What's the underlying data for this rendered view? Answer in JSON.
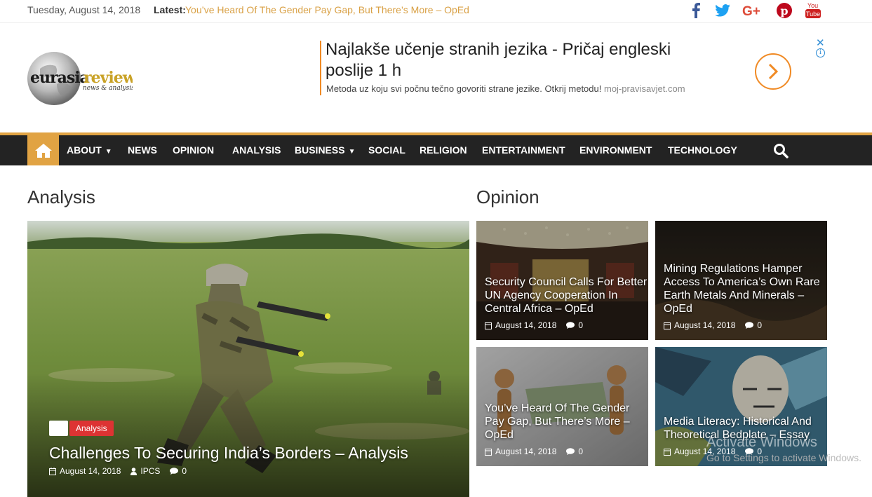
{
  "topbar": {
    "date": "Tuesday, August 14, 2018",
    "latest_label": "Latest:",
    "latest_link": "You’ve Heard Of The Gender Pay Gap, But There’s More – OpEd",
    "social": [
      "facebook-icon",
      "twitter-icon",
      "google-plus-icon",
      "pinterest-icon",
      "youtube-icon"
    ]
  },
  "logo": {
    "main": "eurasiareview",
    "sub": "news & analysis"
  },
  "ad": {
    "title": "Najlakše učenje stranih jezika - Pričaj engleski poslije 1 h",
    "description": "Metoda uz koju svi počnu tečno govoriti strane jezike. Otkrij metodu!",
    "domain": "moj-pravisavjet.com",
    "close": "✕",
    "info": "i"
  },
  "nav": {
    "items": [
      "About",
      "News",
      "Opinion",
      "Analysis",
      "Business",
      "Social",
      "Religion",
      "Entertainment",
      "Environment",
      "Technology"
    ],
    "caret": "⌄"
  },
  "sections": {
    "analysis": "Analysis",
    "opinion": "Opinion"
  },
  "feature": {
    "category": "Analysis",
    "title": "Challenges To Securing India’s Borders – Analysis",
    "date": "August 14, 2018",
    "author": "IPCS",
    "comments": "0"
  },
  "opinion_cards": [
    {
      "title": "Security Council Calls For Better UN Agency Cooperation In Central Africa – OpEd",
      "date": "August 14, 2018",
      "comments": "0"
    },
    {
      "title": "Mining Regulations Hamper Access To America’s Own Rare Earth Metals And Minerals – OpEd",
      "date": "August 14, 2018",
      "comments": "0"
    },
    {
      "title": "You’ve Heard Of The Gender Pay Gap, But There’s More – OpEd",
      "date": "August 14, 2018",
      "comments": "0"
    },
    {
      "title": "Media Literacy: Historical And Theoretical Bedplate – Essay",
      "date": "August 14, 2018",
      "comments": "0"
    }
  ],
  "watermark": {
    "line1": "Activate Windows",
    "line2": "Go to Settings to activate Windows."
  },
  "colors": {
    "accent": "#e1a343",
    "nav_bg": "#232323",
    "badge": "#dd3333",
    "ad_orange": "#f08a24"
  }
}
